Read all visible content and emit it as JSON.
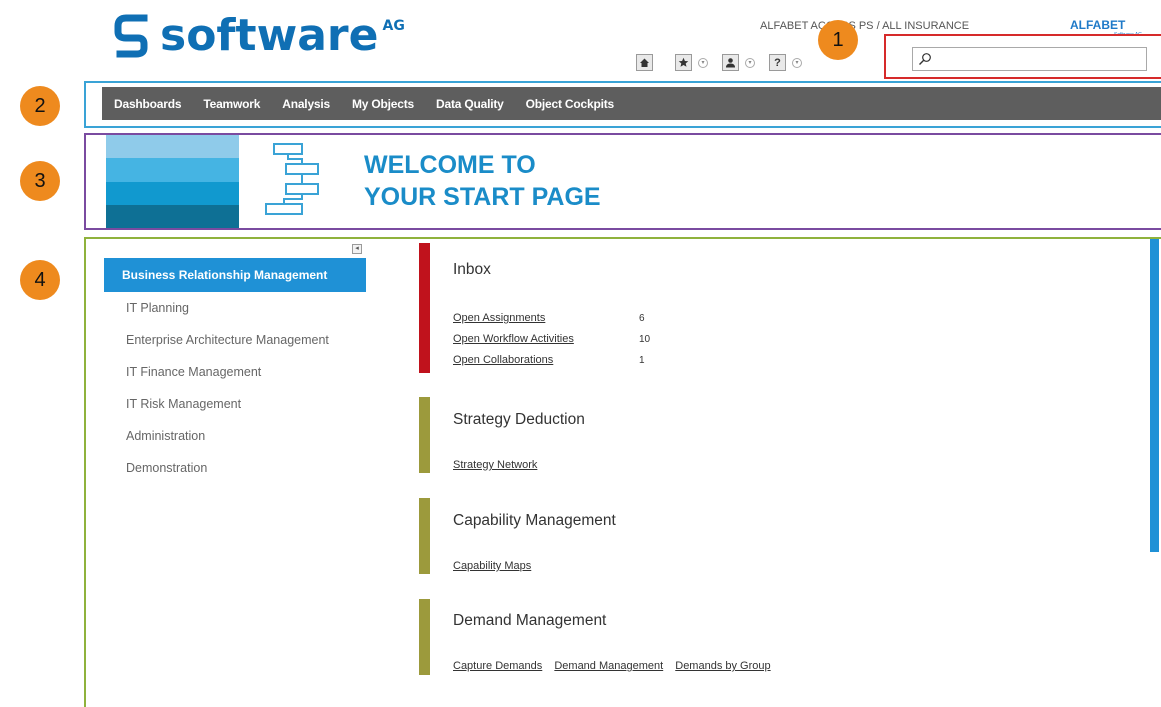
{
  "header": {
    "logo_text": "software",
    "logo_sup": "AG",
    "context": "ALFABET ACCESS PS / ALL INSURANCE",
    "brand": "ALFABET",
    "brand_sub": "Software AG",
    "search": {
      "value": "",
      "placeholder": ""
    },
    "icons": [
      "home-icon",
      "favorites-icon",
      "user-icon",
      "help-icon"
    ]
  },
  "badges": {
    "b1": "1",
    "b2": "2",
    "b3": "3",
    "b4": "4"
  },
  "nav": {
    "items": [
      "Dashboards",
      "Teamwork",
      "Analysis",
      "My Objects",
      "Data Quality",
      "Object Cockpits"
    ]
  },
  "welcome": {
    "line1": "WELCOME TO",
    "line2": "YOUR START PAGE",
    "stripe_colors": [
      "#8fcbea",
      "#45b4e3",
      "#1199cf",
      "#0e7095"
    ]
  },
  "menu": {
    "items": [
      "Business Relationship Management",
      "IT Planning",
      "Enterprise Architecture Management",
      "IT Finance Management",
      "IT Risk Management",
      "Administration",
      "Demonstration"
    ],
    "active_index": 0
  },
  "sections": {
    "inbox": {
      "title": "Inbox",
      "color": "#c0121c",
      "rows": [
        {
          "label": "Open Assignments",
          "count": "6"
        },
        {
          "label": "Open Workflow Activities",
          "count": "10"
        },
        {
          "label": "Open Collaborations",
          "count": "1"
        }
      ]
    },
    "strategy": {
      "title": "Strategy Deduction",
      "color": "#9c9a3c",
      "links": [
        "Strategy Network"
      ]
    },
    "capability": {
      "title": "Capability Management",
      "color": "#9c9a3c",
      "links": [
        "Capability Maps"
      ]
    },
    "demand": {
      "title": "Demand Management",
      "color": "#9c9a3c",
      "links": [
        "Capture Demands",
        "Demand Management",
        "Demands by Group"
      ]
    }
  },
  "colors": {
    "brand_blue": "#0f6fb4",
    "nav_gray": "#5e5e5e",
    "active_blue": "#1f91d6",
    "badge_orange": "#ee8a1e",
    "frame_blue": "#3aa3d6",
    "frame_purple": "#7a4ba0",
    "frame_green": "#8fb23c",
    "frame_red": "#d62a2a"
  }
}
